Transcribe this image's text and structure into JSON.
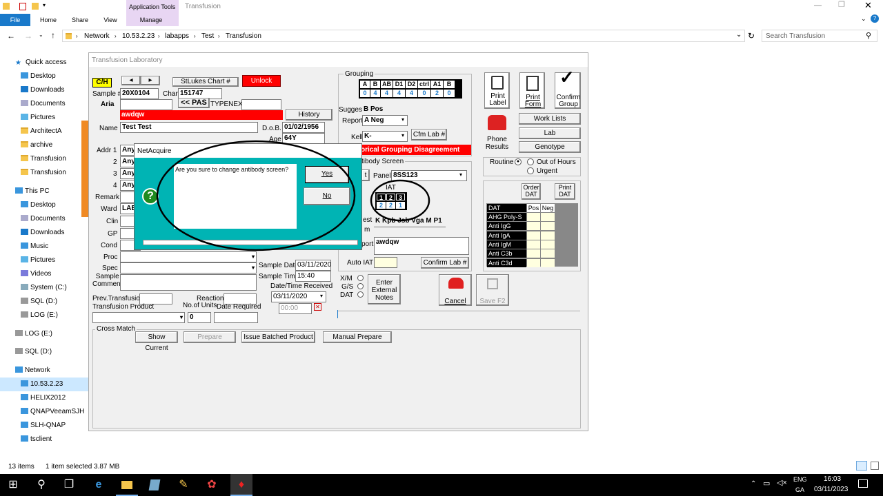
{
  "explorer": {
    "title": "Transfusion",
    "app_tools": "Application Tools",
    "tabs": [
      "File",
      "Home",
      "Share",
      "View",
      "Manage"
    ],
    "breadcrumb": [
      "Network",
      "10.53.2.23",
      "labapps",
      "Test",
      "Transfusion"
    ],
    "search_placeholder": "Search Transfusion",
    "status_items": "13 items",
    "status_selected": "1 item selected  3.87 MB",
    "nav": {
      "quick_access": "Quick access",
      "quick": [
        "Desktop",
        "Downloads",
        "Documents",
        "Pictures",
        "ArchitectA",
        "archive",
        "Transfusion",
        "Transfusion"
      ],
      "this_pc": "This PC",
      "pc": [
        "Desktop",
        "Documents",
        "Downloads",
        "Music",
        "Pictures",
        "Videos",
        "System (C:)",
        "SQL (D:)",
        "LOG (E:)"
      ],
      "log": "LOG (E:)",
      "sql": "SQL (D:)",
      "network": "Network",
      "net": [
        "10.53.2.23",
        "HELIX2012",
        "QNAPVeeamSJH",
        "SLH-QNAP",
        "tsclient"
      ]
    }
  },
  "lab": {
    "window_title": "Transfusion Laboratory",
    "ch": "C/H",
    "stlukes": "StLukes Chart #",
    "unlock": "Unlock",
    "sample_label": "Sample #",
    "sample": "20X0104",
    "chart_label": "Chart",
    "chart": "151747",
    "aria": "Aria",
    "pas": "<< PAS",
    "typenex": "TYPENEX",
    "alert": "awdqw",
    "history": "History",
    "name_label": "Name",
    "name": "Test Test",
    "dob_label": "D.o.B.",
    "dob": "01/02/1956",
    "age_label": "Age",
    "age": "64Y",
    "addr_labels": [
      "Addr 1",
      "2",
      "3",
      "4"
    ],
    "addr_value": "Any",
    "remark": "Remark",
    "ward": "Ward",
    "ward_value": "LAB",
    "clin": "Clin",
    "gp": "GP",
    "cond": "Cond",
    "proc": "Proc",
    "spec": "Spec",
    "sample_comment": "Sample\nComment",
    "sample_date_label": "Sample Date",
    "sample_date": "03/11/2020",
    "sample_time_label": "Sample Time",
    "sample_time": "15:40",
    "dt_received": "Date/Time Received",
    "received": "03/11/2020",
    "received_time": "00:00",
    "prev_transfusion": "Prev.Transfusion",
    "reaction": "Reaction",
    "transfusion_product": "Transfusion Product",
    "no_units": "No.of Units",
    "units": "0",
    "date_required": "Date Required",
    "grouping": "Grouping",
    "group_headers": [
      "A",
      "B",
      "AB",
      "D1",
      "D2",
      "ctrl",
      "A1",
      "B"
    ],
    "group_values": [
      "0",
      "4",
      "4",
      "4",
      "4",
      "0",
      "2",
      "0"
    ],
    "suggest_label": "Suggest",
    "suggest": "B Pos",
    "report_label": "Report",
    "report": "A Neg",
    "kell_label": "Kell",
    "kell": "K-",
    "cfm_lab": "Cfm Lab #",
    "disagreement": "orical Grouping Disagreement",
    "antibody_screen": "tibody Screen",
    "panel_label": "Panel",
    "panel": "8SS123",
    "iat": "IAT",
    "iat_headers": [
      "1",
      "2",
      "3"
    ],
    "iat_values": [
      "2",
      "2",
      "1"
    ],
    "est": "est",
    "m": "m",
    "kkpb": "K Kpb Jsb Vga M P1",
    "port": "port",
    "port_value": "awdqw",
    "auto_iat": "Auto IAT",
    "confirm_lab": "Confirm Lab #",
    "print_label": "Print\nLabel",
    "print_form": "Print\nForm",
    "confirm_group": "Confirm\nGroup",
    "phone_results": "Phone\nResults",
    "work_lists": "Work Lists",
    "lab_btn": "Lab",
    "genotype": "Genotype",
    "routine": "Routine",
    "out_of_hours": "Out of Hours",
    "urgent": "Urgent",
    "order_dat": "Order\nDAT",
    "print_dat": "Print\nDAT",
    "dat_headers": [
      "DAT",
      "Pos",
      "Neg"
    ],
    "dat_rows": [
      "AHG Poly-S",
      "Anti IgG",
      "Anti IgA",
      "Anti IgM",
      "Anti C3b",
      "Anti C3d"
    ],
    "xm": "X/M",
    "gs": "G/S",
    "dat": "DAT",
    "enter_notes": "Enter\nExternal\nNotes",
    "cancel": "Cancel",
    "save": "Save F2",
    "cross_match": "Cross Match",
    "show_current": "Show Current",
    "prepare": "Prepare",
    "issue_batched": "Issue Batched Product",
    "manual_prepare": "Manual Prepare"
  },
  "dialog": {
    "title": "NetAcquire",
    "message": "Are you sure to change antibody screen?",
    "yes": "Yes",
    "no": "No"
  },
  "taskbar": {
    "lang1": "ENG",
    "lang2": "GA",
    "time": "16:03",
    "date": "03/11/2023"
  },
  "colors": {
    "red": "#ff0000",
    "teal": "#00b4b4",
    "yellow": "#ffff00",
    "navy": "#000080"
  }
}
